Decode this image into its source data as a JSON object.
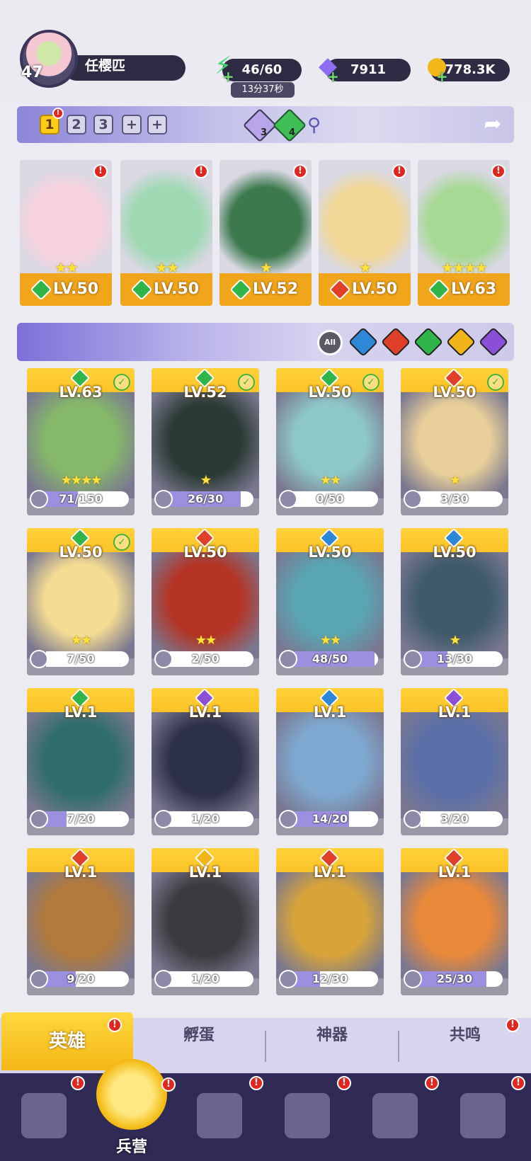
{
  "player": {
    "level": "47",
    "name": "任樱匹"
  },
  "resources": {
    "energy": {
      "icon": "lightning-icon",
      "value": "46/60",
      "timer": "13分37秒"
    },
    "gems": {
      "icon": "diamond-icon",
      "value": "7911"
    },
    "gold": {
      "icon": "coin-icon",
      "value": "778.3K"
    }
  },
  "team_tabs": [
    "1",
    "2",
    "3",
    "+",
    "+"
  ],
  "team_gems": {
    "purple": "3",
    "green": "4"
  },
  "team": [
    {
      "level": "LV.50",
      "stars": "★★",
      "element": "nature",
      "color": "#f7d3de"
    },
    {
      "level": "LV.50",
      "stars": "★★",
      "element": "nature",
      "color": "#9fd9b3"
    },
    {
      "level": "LV.52",
      "stars": "★",
      "element": "nature",
      "color": "#3c7a4e"
    },
    {
      "level": "LV.50",
      "stars": "★",
      "element": "fire",
      "color": "#f1d796"
    },
    {
      "level": "LV.63",
      "stars": "★★★★",
      "element": "nature",
      "color": "#a6d993"
    }
  ],
  "filters": [
    "All"
  ],
  "heroes": [
    {
      "level": "LV.63",
      "progress": "71/150",
      "ratio": 0.47,
      "element": "nature",
      "checked": true,
      "stars": "★★★★",
      "color": "#86b86a"
    },
    {
      "level": "LV.52",
      "progress": "26/30",
      "ratio": 0.87,
      "element": "nature",
      "checked": true,
      "stars": "★",
      "color": "#2a3a34"
    },
    {
      "level": "LV.50",
      "progress": "0/50",
      "ratio": 0,
      "element": "nature",
      "checked": true,
      "stars": "★★",
      "color": "#8ec7c9"
    },
    {
      "level": "LV.50",
      "progress": "3/30",
      "ratio": 0.1,
      "element": "fire",
      "checked": true,
      "stars": "★",
      "color": "#e8cf9a"
    },
    {
      "level": "LV.50",
      "progress": "7/50",
      "ratio": 0.14,
      "element": "nature",
      "checked": true,
      "stars": "★★",
      "color": "#f4dc93"
    },
    {
      "level": "LV.50",
      "progress": "2/50",
      "ratio": 0.04,
      "element": "fire",
      "checked": false,
      "stars": "★★",
      "color": "#b53324"
    },
    {
      "level": "LV.50",
      "progress": "48/50",
      "ratio": 0.96,
      "element": "water",
      "checked": false,
      "stars": "★★",
      "color": "#5aa5b3"
    },
    {
      "level": "LV.50",
      "progress": "13/30",
      "ratio": 0.43,
      "element": "water",
      "checked": false,
      "stars": "★",
      "color": "#3e5a6b"
    },
    {
      "level": "LV.1",
      "progress": "7/20",
      "ratio": 0.35,
      "element": "nature",
      "checked": false,
      "stars": "",
      "color": "#2f6d6b"
    },
    {
      "level": "LV.1",
      "progress": "1/20",
      "ratio": 0.05,
      "element": "dark",
      "checked": false,
      "stars": "",
      "color": "#2d3148"
    },
    {
      "level": "LV.1",
      "progress": "14/20",
      "ratio": 0.7,
      "element": "water",
      "checked": false,
      "stars": "",
      "color": "#7fa8d0"
    },
    {
      "level": "LV.1",
      "progress": "3/20",
      "ratio": 0.15,
      "element": "dark",
      "checked": false,
      "stars": "",
      "color": "#5a6fa8"
    },
    {
      "level": "LV.1",
      "progress": "9/20",
      "ratio": 0.45,
      "element": "fire",
      "checked": false,
      "stars": "",
      "color": "#b27a3c"
    },
    {
      "level": "LV.1",
      "progress": "1/20",
      "ratio": 0.05,
      "element": "light",
      "checked": false,
      "stars": "",
      "color": "#3c3a3e"
    },
    {
      "level": "LV.1",
      "progress": "12/30",
      "ratio": 0.4,
      "element": "fire",
      "checked": false,
      "stars": "",
      "color": "#d8a43a"
    },
    {
      "level": "LV.1",
      "progress": "25/30",
      "ratio": 0.83,
      "element": "fire",
      "checked": false,
      "stars": "",
      "color": "#e9893a"
    }
  ],
  "element_colors": {
    "nature": "#2fb54a",
    "fire": "#e0402a",
    "water": "#2f87d8",
    "light": "#f1b51a",
    "dark": "#8a4fd6"
  },
  "sub_tabs": [
    "英雄",
    "孵蛋",
    "神器",
    "共鸣"
  ],
  "nav": {
    "active_label": "兵营"
  }
}
